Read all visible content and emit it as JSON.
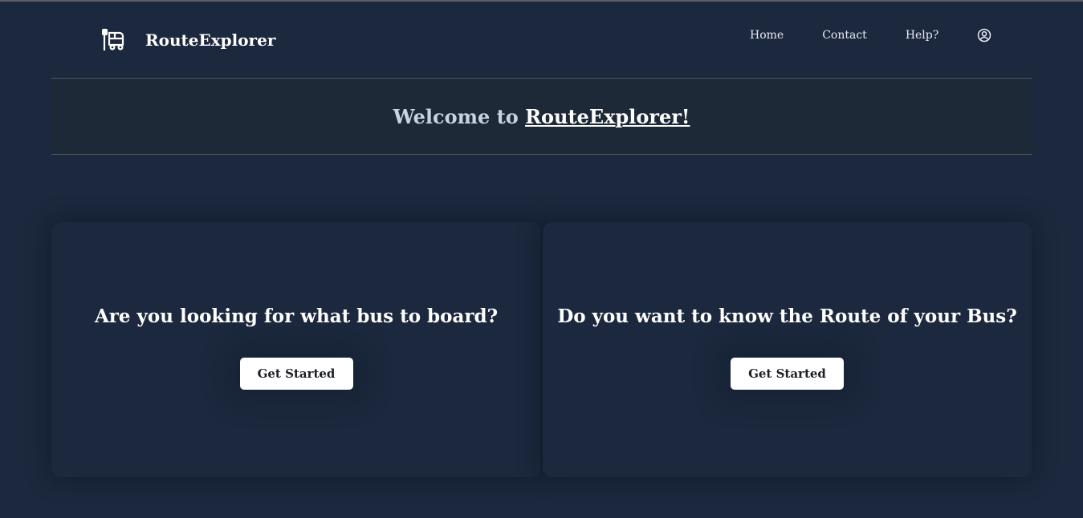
{
  "header": {
    "brand_name": "RouteExplorer",
    "brand_icon": "bus-stop-icon",
    "nav": {
      "home": "Home",
      "contact": "Contact",
      "help": "Help?"
    },
    "user_icon": "user-circle-icon"
  },
  "welcome": {
    "prefix": "Welcome to ",
    "brand": "RouteExplorer!"
  },
  "cards": [
    {
      "title": "Are you looking for what bus to board?",
      "button_label": "Get Started"
    },
    {
      "title": "Do you want to know the Route of your Bus?",
      "button_label": "Get Started"
    }
  ],
  "colors": {
    "background": "#1b283d",
    "welcome_band": "#1d2937",
    "welcome_text": "#c7d3e3",
    "button_bg": "#ffffff"
  }
}
